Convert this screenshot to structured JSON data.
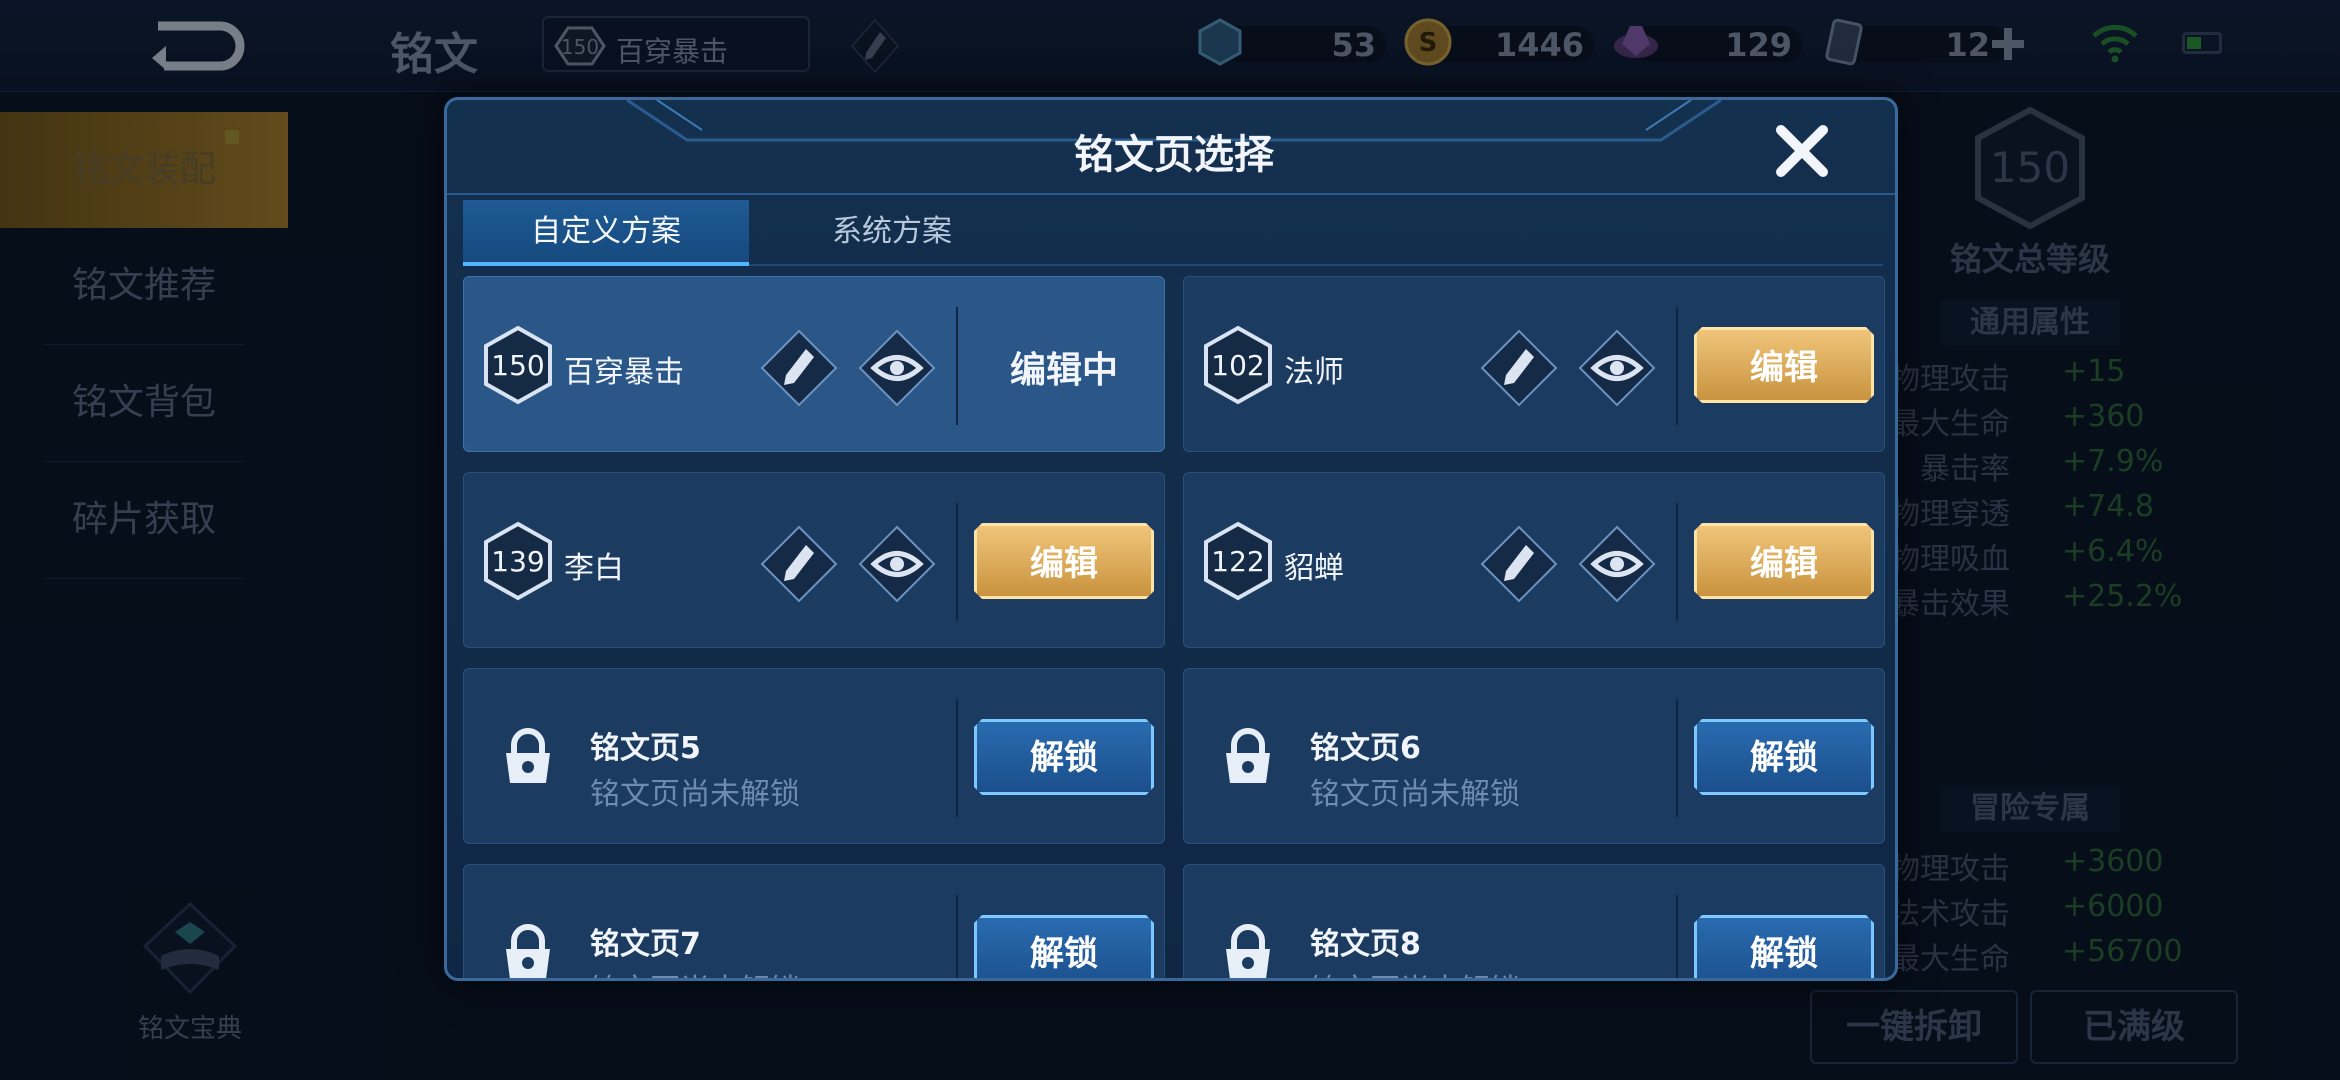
{
  "topbar": {
    "title": "铭文",
    "current_page": {
      "level": "150",
      "name": "百穿暴击"
    },
    "currencies": [
      {
        "icon": "gem-icon",
        "value": "53"
      },
      {
        "icon": "gold-coin-icon",
        "value": "1446"
      },
      {
        "icon": "crystal-icon",
        "value": "129"
      },
      {
        "icon": "card-icon",
        "value": "12"
      }
    ]
  },
  "leftnav": {
    "items": [
      "铭文装配",
      "铭文推荐",
      "铭文背包",
      "碎片获取"
    ],
    "active_index": 0,
    "codex_label": "铭文宝典"
  },
  "stats": {
    "total_level": "150",
    "total_level_label": "铭文总等级",
    "general_title": "通用属性",
    "general": [
      {
        "label": "物理攻击",
        "value": "+15"
      },
      {
        "label": "最大生命",
        "value": "+360"
      },
      {
        "label": "暴击率",
        "value": "+7.9%"
      },
      {
        "label": "物理穿透",
        "value": "+74.8"
      },
      {
        "label": "物理吸血",
        "value": "+6.4%"
      },
      {
        "label": "暴击效果",
        "value": "+25.2%"
      }
    ],
    "adventure_title": "冒险专属",
    "adventure": [
      {
        "label": "物理攻击",
        "value": "+3600"
      },
      {
        "label": "法术攻击",
        "value": "+6000"
      },
      {
        "label": "最大生命",
        "value": "+56700"
      }
    ],
    "btn_unequip": "一键拆卸",
    "btn_maxed": "已满级"
  },
  "modal": {
    "title": "铭文页选择",
    "tabs": [
      "自定义方案",
      "系统方案"
    ],
    "active_tab": 0,
    "pages": [
      {
        "level": "150",
        "name": "百穿暴击",
        "status": "编辑中",
        "selected": true
      },
      {
        "level": "102",
        "name": "法师",
        "action": "编辑"
      },
      {
        "level": "139",
        "name": "李白",
        "action": "编辑"
      },
      {
        "level": "122",
        "name": "貂蝉",
        "action": "编辑"
      }
    ],
    "locked": [
      {
        "title": "铭文页5",
        "subtitle": "铭文页尚未解锁",
        "action": "解锁"
      },
      {
        "title": "铭文页6",
        "subtitle": "铭文页尚未解锁",
        "action": "解锁"
      },
      {
        "title": "铭文页7",
        "subtitle": "铭文页尚未解锁",
        "action": "解锁"
      },
      {
        "title": "铭文页8",
        "subtitle": "铭文页尚未解锁",
        "action": "解锁"
      }
    ]
  },
  "colors": {
    "accent_gold": "#e2b063",
    "accent_blue": "#52b6ff",
    "stat_green": "#2f6a35"
  }
}
